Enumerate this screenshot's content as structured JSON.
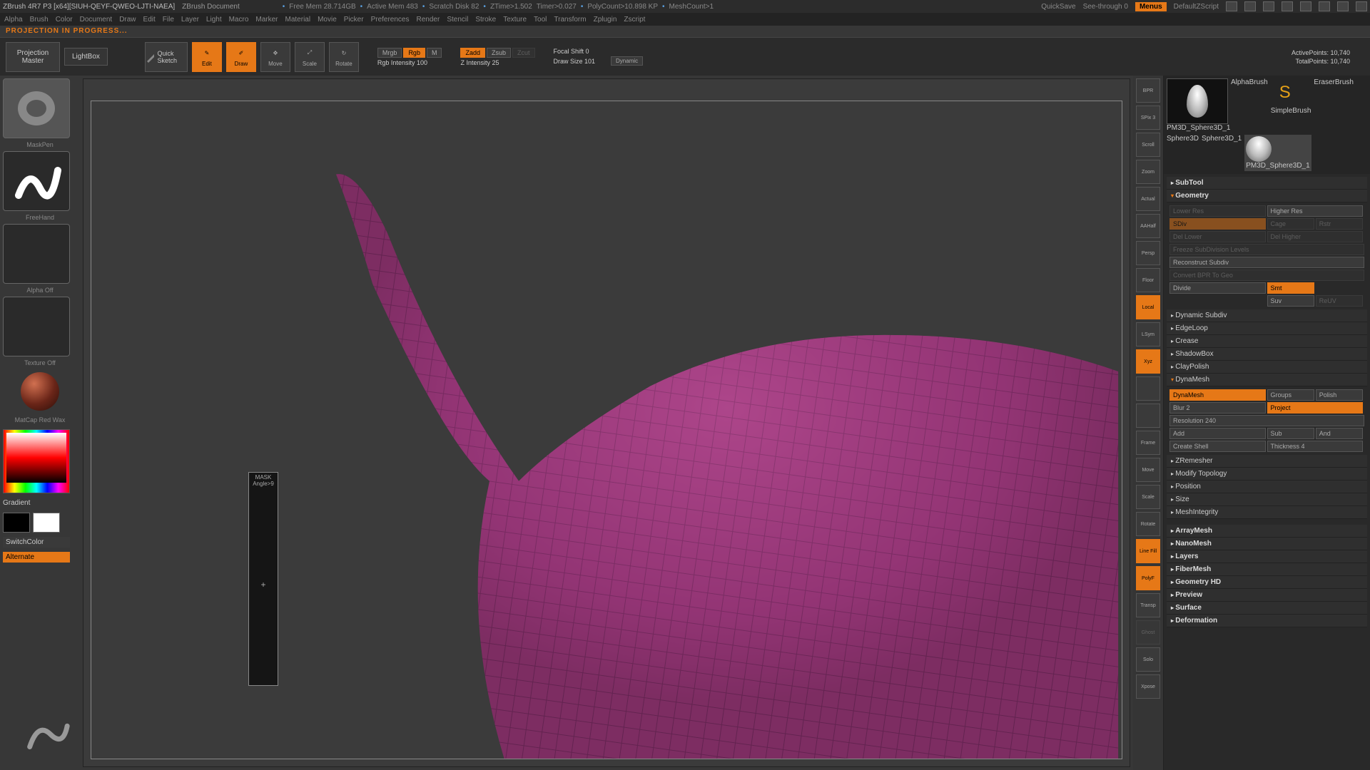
{
  "titlebar": {
    "app": "ZBrush 4R7 P3 [x64][SIUH-QEYF-QWEO-LJTI-NAEA]",
    "doc": "ZBrush Document",
    "stats": {
      "freemem": "Free Mem 28.714GB",
      "activemem": "Active Mem 483",
      "scratch": "Scratch Disk 82",
      "ztime": "ZTime>1.502",
      "timer": "Timer>0.027",
      "polycount": "PolyCount>10.898 KP",
      "meshcount": "MeshCount>1"
    },
    "quicksave": "QuickSave",
    "seethrough": "See-through  0",
    "menus": "Menus",
    "zscript": "DefaultZScript"
  },
  "menubar": [
    "Alpha",
    "Brush",
    "Color",
    "Document",
    "Draw",
    "Edit",
    "File",
    "Layer",
    "Light",
    "Macro",
    "Marker",
    "Material",
    "Movie",
    "Picker",
    "Preferences",
    "Render",
    "Stencil",
    "Stroke",
    "Texture",
    "Tool",
    "Transform",
    "Zplugin",
    "Zscript"
  ],
  "status": "PROJECTION IN PROGRESS...",
  "shelf": {
    "projmaster": "Projection\nMaster",
    "lightbox": "LightBox",
    "qsketch": "Quick\nSketch",
    "modes": {
      "edit": "Edit",
      "draw": "Draw",
      "move": "Move",
      "scale": "Scale",
      "rotate": "Rotate"
    },
    "mrgb": "Mrgb",
    "rgb": "Rgb",
    "m": "M",
    "rgbint": "Rgb Intensity 100",
    "zadd": "Zadd",
    "zsub": "Zsub",
    "zcut": "Zcut",
    "zint": "Z Intensity 25",
    "focal": "Focal Shift 0",
    "drawsize": "Draw Size 101",
    "dynamic": "Dynamic",
    "activepts": "ActivePoints: 10,740",
    "totalpts": "TotalPoints: 10,740"
  },
  "left": {
    "brush": "MaskPen",
    "stroke": "FreeHand",
    "alpha": "Alpha Off",
    "texture": "Texture Off",
    "material": "MatCap Red Wax",
    "gradient": "Gradient",
    "switchcolor": "SwitchColor",
    "alternate": "Alternate"
  },
  "rnav": [
    "BPR",
    "SPix 3",
    "Scroll",
    "Zoom",
    "Actual",
    "AAHalf",
    "Persp",
    "Floor",
    "Local",
    "LSym",
    "Xyz",
    "",
    "",
    "Frame",
    "Move",
    "Scale",
    "Rotate",
    "Line Fill",
    "PolyF",
    "Transp",
    "Ghost",
    "Solo",
    "Xpose"
  ],
  "tools": {
    "items": [
      "PM3D_Sphere3D_1",
      "AlphaBrush",
      "SimpleBrush",
      "EraserBrush",
      "Sphere3D",
      "Sphere3D_1",
      "PM3D_Sphere3D_1"
    ]
  },
  "panel": {
    "subtool": "SubTool",
    "geometry": "Geometry",
    "lowerres": "Lower Res",
    "higherres": "Higher Res",
    "sdiv": "SDiv",
    "cage": "Cage",
    "rstr": "Rstr",
    "dellower": "Del Lower",
    "delhigher": "Del Higher",
    "freeze": "Freeze SubDivision Levels",
    "reconstruct": "Reconstruct Subdiv",
    "convert": "Convert BPR To Geo",
    "divide": "Divide",
    "smt": "Smt",
    "suv": "Suv",
    "reuv": "ReUV",
    "dynsubdiv": "Dynamic Subdiv",
    "edgeloop": "EdgeLoop",
    "crease": "Crease",
    "shadowbox": "ShadowBox",
    "claypolish": "ClayPolish",
    "dynamesh": "DynaMesh",
    "dynameshbtn": "DynaMesh",
    "groups": "Groups",
    "polish": "Polish",
    "blur": "Blur 2",
    "project": "Project",
    "resolution": "Resolution 240",
    "add": "Add",
    "sub": "Sub",
    "and": "And",
    "createshell": "Create Shell",
    "thickness": "Thickness 4",
    "zremesher": "ZRemesher",
    "modifytopo": "Modify Topology",
    "position": "Position",
    "size": "Size",
    "meshintegrity": "MeshIntegrity",
    "arraymesh": "ArrayMesh",
    "nanomesh": "NanoMesh",
    "layers": "Layers",
    "fibermesh": "FiberMesh",
    "geometryhd": "Geometry HD",
    "preview": "Preview",
    "surface": "Surface",
    "deformation": "Deformation"
  },
  "floatpanel": {
    "l1": "MASK",
    "l2": "Angle>9",
    "plus": "+"
  }
}
